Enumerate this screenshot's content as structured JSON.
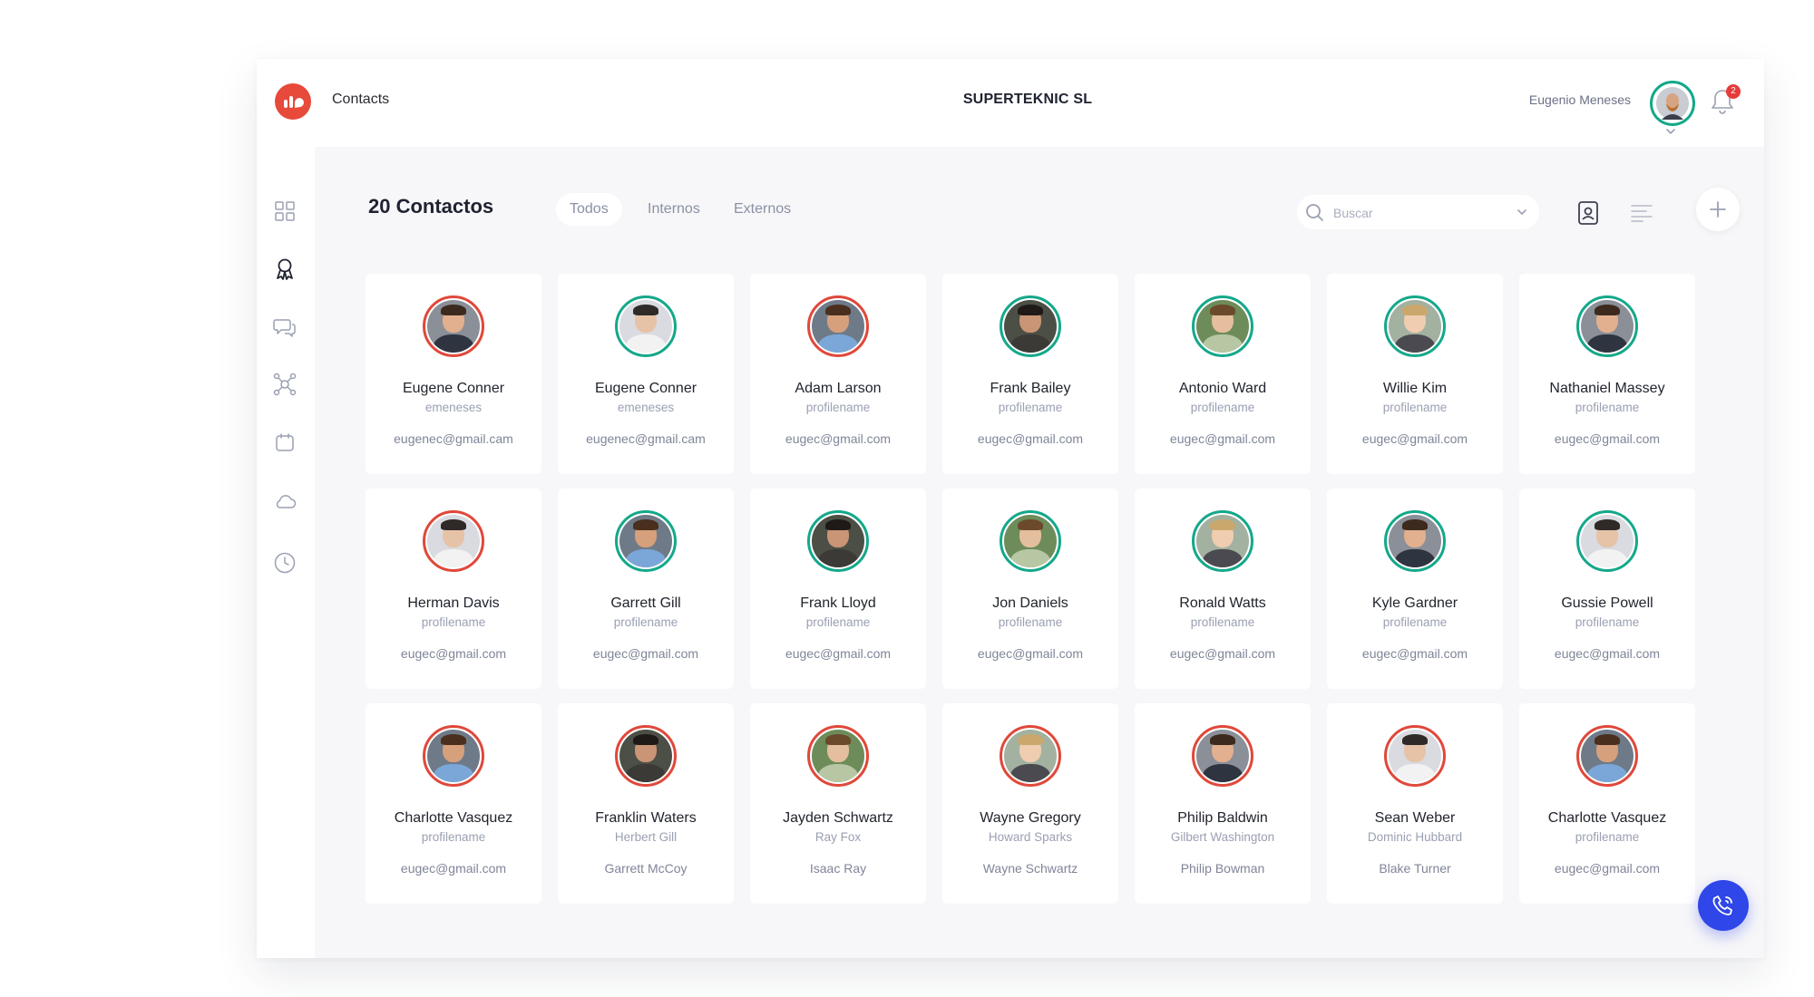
{
  "header": {
    "app_title": "Contacts",
    "company": "SUPERTEKNIC SL",
    "user_name": "Eugenio Meneses",
    "notification_count": "2"
  },
  "sidebar": {
    "items": [
      {
        "icon": "grid-icon"
      },
      {
        "icon": "award-icon"
      },
      {
        "icon": "chat-icon"
      },
      {
        "icon": "network-icon"
      },
      {
        "icon": "calendar-icon"
      },
      {
        "icon": "cloud-icon"
      },
      {
        "icon": "clock-icon"
      }
    ]
  },
  "main": {
    "title": "20 Contactos",
    "tabs": [
      {
        "label": "Todos",
        "active": true
      },
      {
        "label": "Internos",
        "active": false
      },
      {
        "label": "Externos",
        "active": false
      }
    ],
    "search": {
      "placeholder": "Buscar"
    }
  },
  "colors": {
    "accent_green": "#14a88a",
    "accent_red": "#e0483a",
    "call_blue": "#2f46e8",
    "brand_red": "#e7493a"
  },
  "contacts": [
    {
      "name": "Eugene Conner",
      "sub": "emeneses",
      "detail": "eugenec@gmail.cam",
      "ring": "red"
    },
    {
      "name": "Eugene Conner",
      "sub": "emeneses",
      "detail": "eugenec@gmail.cam",
      "ring": "green"
    },
    {
      "name": "Adam Larson",
      "sub": "profilename",
      "detail": "eugec@gmail.com",
      "ring": "red"
    },
    {
      "name": "Frank Bailey",
      "sub": "profilename",
      "detail": "eugec@gmail.com",
      "ring": "green"
    },
    {
      "name": "Antonio Ward",
      "sub": "profilename",
      "detail": "eugec@gmail.com",
      "ring": "green"
    },
    {
      "name": "Willie Kim",
      "sub": "profilename",
      "detail": "eugec@gmail.com",
      "ring": "green"
    },
    {
      "name": "Nathaniel Massey",
      "sub": "profilename",
      "detail": "eugec@gmail.com",
      "ring": "green"
    },
    {
      "name": "Herman Davis",
      "sub": "profilename",
      "detail": "eugec@gmail.com",
      "ring": "red"
    },
    {
      "name": "Garrett Gill",
      "sub": "profilename",
      "detail": "eugec@gmail.com",
      "ring": "green"
    },
    {
      "name": "Frank Lloyd",
      "sub": "profilename",
      "detail": "eugec@gmail.com",
      "ring": "green"
    },
    {
      "name": "Jon Daniels",
      "sub": "profilename",
      "detail": "eugec@gmail.com",
      "ring": "green"
    },
    {
      "name": "Ronald Watts",
      "sub": "profilename",
      "detail": "eugec@gmail.com",
      "ring": "green"
    },
    {
      "name": "Kyle Gardner",
      "sub": "profilename",
      "detail": "eugec@gmail.com",
      "ring": "green"
    },
    {
      "name": "Gussie Powell",
      "sub": "profilename",
      "detail": "eugec@gmail.com",
      "ring": "green"
    },
    {
      "name": "Charlotte Vasquez",
      "sub": "profilename",
      "detail": "eugec@gmail.com",
      "ring": "red"
    },
    {
      "name": "Franklin Waters",
      "sub": "Herbert Gill",
      "detail": "Garrett McCoy",
      "ring": "red"
    },
    {
      "name": "Jayden Schwartz",
      "sub": "Ray Fox",
      "detail": "Isaac Ray",
      "ring": "red"
    },
    {
      "name": "Wayne Gregory",
      "sub": "Howard Sparks",
      "detail": "Wayne Schwartz",
      "ring": "red"
    },
    {
      "name": "Philip Baldwin",
      "sub": "Gilbert Washington",
      "detail": "Philip Bowman",
      "ring": "red"
    },
    {
      "name": "Sean Weber",
      "sub": "Dominic Hubbard",
      "detail": "Blake Turner",
      "ring": "red"
    },
    {
      "name": "Charlotte Vasquez",
      "sub": "profilename",
      "detail": "eugec@gmail.com",
      "ring": "red"
    }
  ]
}
